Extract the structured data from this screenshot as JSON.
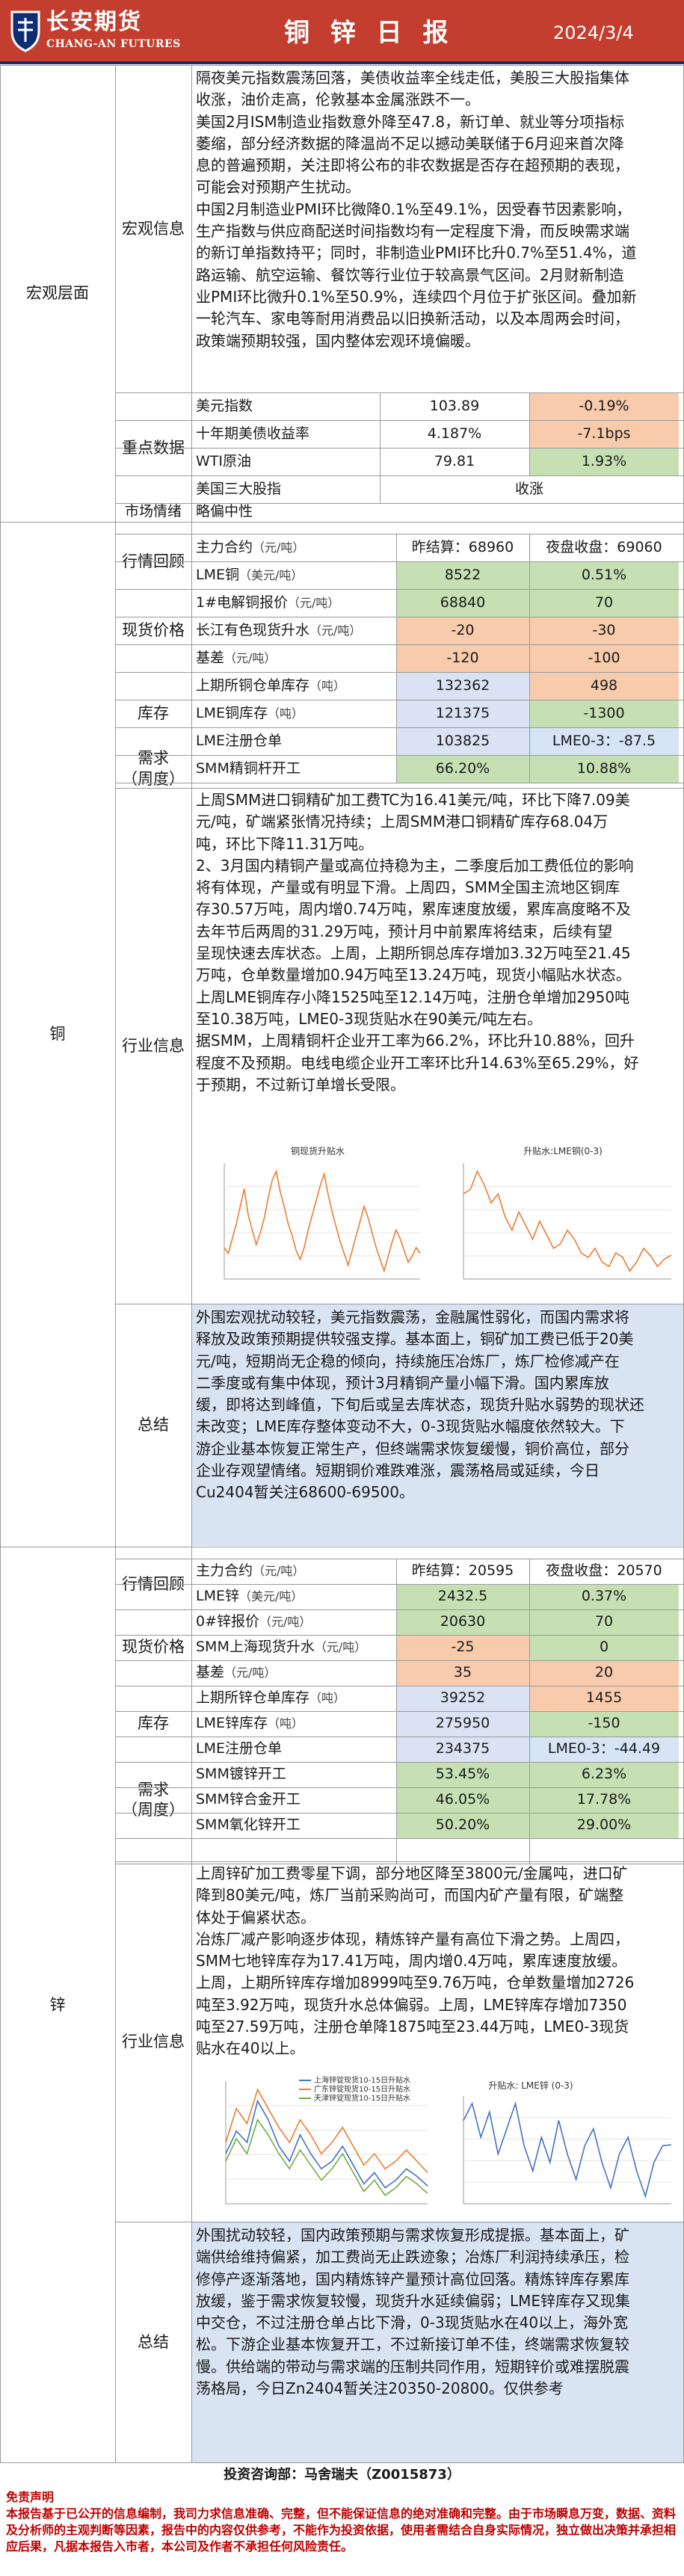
{
  "header": {
    "company_cn": "长安期货",
    "company_en": "CHANG-AN FUTURES",
    "title": "铜 锌 日 报",
    "date": "2024/3/4"
  },
  "macro": {
    "section_label": "宏观层面",
    "info_label": "宏观信息",
    "info_text": "隔夜美元指数震荡回落，美债收益率全线走低，美股三大股指集体\n收涨，油价走高，伦敦基本金属涨跌不一。\n美国2月ISM制造业指数意外降至47.8，新订单、就业等分项指标\n萎缩，部分经济数据的降温尚不足以撼动美联储于6月迎来首次降\n息的普遍预期，关注即将公布的非农数据是否存在超预期的表现，\n可能会对预期产生扰动。\n中国2月制造业PMI环比微降0.1%至49.1%，因受春节因素影响，\n生产指数与供应商配送时间指数均有一定程度下滑，而反映需求端\n的新订单指数持平；同时，非制造业PMI环比升0.7%至51.4%，道\n路运输、航空运输、餐饮等行业位于较高景气区间。2月财新制造\n业PMI环比微升0.1%至50.9%，连续四个月位于扩张区间。叠加新\n一轮汽车、家电等耐用消费品以旧换新活动，以及本周两会时间，\n政策端预期较强，国内整体宏观环境偏暖。",
    "indicators_label": "重点数据",
    "indicators": [
      {
        "name": "美元指数",
        "value": "103.89",
        "change": "-0.19%"
      },
      {
        "name": "十年期美债收益率",
        "value": "4.187%",
        "change": "-7.1bps"
      },
      {
        "name": "WTI原油",
        "value": "79.81",
        "change": "1.93%"
      },
      {
        "name": "美国三大股指",
        "value": "",
        "change": "收涨"
      }
    ],
    "sentiment_label": "市场情绪",
    "sentiment_value": "略偏中性"
  },
  "copper": {
    "section_label": "铜",
    "market_label": "行情回顾",
    "main_contract": "主力合约",
    "main_contract_unit": "（元/吨）",
    "close_label": "昨结算：68960",
    "night_label": "夜盘收盘：69060",
    "lme_name": "LME铜",
    "lme_unit": "（美元/吨）",
    "lme_value": "8522",
    "lme_change": "0.51%",
    "spot_label": "现货价格",
    "spot_rows": [
      {
        "name": "1#电解铜报价",
        "unit": "（元/吨）",
        "value": "68840",
        "change": "70"
      },
      {
        "name": "长江有色现货升水",
        "unit": "（元/吨）",
        "value": "-20",
        "change": "-30"
      },
      {
        "name": "基差",
        "unit": "（元/吨）",
        "value": "-120",
        "change": "-100"
      }
    ],
    "inventory_label": "库存",
    "inventory_rows": [
      {
        "name": "上期所铜仓单库存",
        "unit": "（吨）",
        "value": "132362",
        "change": "498"
      },
      {
        "name": "LME铜库存",
        "unit": "（吨）",
        "value": "121375",
        "change": "-1300"
      },
      {
        "name": "LME注册仓单",
        "unit": "",
        "value": "103825",
        "change": "LME0-3：-87.5"
      }
    ],
    "demand_label": "需求\n（周度）",
    "demand_rows": [
      {
        "name": "SMM精铜杆开工",
        "value": "66.20%",
        "change": "10.88%"
      }
    ],
    "industry_label": "行业信息",
    "industry_text": "上周SMM进口铜精矿加工费TC为16.41美元/吨，环比下降7.09美\n元/吨，矿端紧张情况持续；上周SMM港口铜精矿库存68.04万\n吨，环比下降11.31万吨。\n2、3月国内精铜产量或高位持稳为主，二季度后加工费低位的影响\n将有体现，产量或有明显下滑。上周四，SMM全国主流地区铜库\n存30.57万吨，周内增0.74万吨，累库速度放缓，累库高度略不及\n去年节后两周的31.29万吨，预计月中前累库将结束，后续有望\n呈现快速去库状态。上周，上期所铜总库存增加3.32万吨至21.45\n万吨，仓单数量增加0.94万吨至13.24万吨，现货小幅贴水状态。\n上周LME铜库存小降1525吨至12.14万吨，注册仓单增加2950吨\n至10.38万吨，LME0-3现货贴水在90美元/吨左右。\n据SMM，上周精铜杆企业开工率为66.2%，环比升10.88%，回升\n程度不及预期。电线电缆企业开工率环比升14.63%至65.29%，好\n于预期，不过新订单增长受限。",
    "chart1_title": "铜现货升贴水",
    "chart2_title": "升贴水:LME铜(0-3)",
    "summary_label": "总结",
    "summary_text": "外围宏观扰动较轻，美元指数震荡，金融属性弱化，而国内需求将\n释放及政策预期提供较强支撑。基本面上，铜矿加工费已低于20美\n元/吨，短期尚无企稳的倾向，持续施压冶炼厂，炼厂检修减产在\n二季度或有集中体现，预计3月精铜产量小幅下滑。国内累库放\n缓，即将达到峰值，下旬后或呈去库状态，现货升贴水弱势的现状还\n未改变；LME库存整体变动不大，0-3现货贴水幅度依然较大。下\n游企业基本恢复正常生产，但终端需求恢复缓慢，铜价高位，部分\n企业存观望情绪。短期铜价难跌难涨，震荡格局或延续，今日\nCu2404暂关注68600-69500。"
  },
  "zinc": {
    "section_label": "锌",
    "market_label": "行情回顾",
    "main_contract": "主力合约",
    "main_contract_unit": "（元/吨）",
    "close_label": "昨结算：20595",
    "night_label": "夜盘收盘：20570",
    "lme_name": "LME锌",
    "lme_unit": "（美元/吨）",
    "lme_value": "2432.5",
    "lme_change": "0.37%",
    "spot_label": "现货价格",
    "spot_rows": [
      {
        "name": "0#锌报价",
        "unit": "（元/吨）",
        "value": "20630",
        "change": "70"
      },
      {
        "name": "SMM上海现货升水",
        "unit": "（元/吨）",
        "value": "-25",
        "change": "0"
      },
      {
        "name": "基差",
        "unit": "（元/吨）",
        "value": "35",
        "change": "20"
      }
    ],
    "inventory_label": "库存",
    "inventory_rows": [
      {
        "name": "上期所锌仓单库存",
        "unit": "（吨）",
        "value": "39252",
        "change": "1455"
      },
      {
        "name": "LME锌库存",
        "unit": "（吨）",
        "value": "275950",
        "change": "-150"
      },
      {
        "name": "LME注册仓单",
        "unit": "",
        "value": "234375",
        "change": "LME0-3：-44.49"
      }
    ],
    "demand_label": "需求\n（周度）",
    "demand_rows": [
      {
        "name": "SMM镀锌开工",
        "value": "53.45%",
        "change": "6.23%"
      },
      {
        "name": "SMM锌合金开工",
        "value": "46.05%",
        "change": "17.78%"
      },
      {
        "name": "SMM氧化锌开工",
        "value": "50.20%",
        "change": "29.00%"
      }
    ],
    "industry_label": "行业信息",
    "industry_text": "上周锌矿加工费零星下调，部分地区降至3800元/金属吨，进口矿\n降到80美元/吨，炼厂当前采购尚可，而国内矿产量有限，矿端整\n体处于偏紧状态。\n冶炼厂减产影响逐步体现，精炼锌产量有高位下滑之势。上周四，\nSMM七地锌库存为17.41万吨，周内增0.4万吨，累库速度放缓。\n上周，上期所锌库存增加8999吨至9.76万吨，仓单数量增加2726\n吨至3.92万吨，现货升水总体偏弱。上周，LME锌库存增加7350\n吨至27.59万吨，注册仓单降1875吨至23.44万吨，LME0-3现货\n贴水在40以上。",
    "chart1_legend": [
      "上海锌锭现货10-15日升贴水",
      "广东锌锭现货10-15日升贴水",
      "天津锌锭现货10-15日升贴水"
    ],
    "chart2_title": "升贴水: LME锌 (0-3)",
    "summary_label": "总结",
    "summary_text": "外围扰动较轻，国内政策预期与需求恢复形成提振。基本面上，矿\n端供给维持偏紧，加工费尚无止跌迹象；冶炼厂利润持续承压，检\n修停产逐渐落地，国内精炼锌产量预计高位回落。精炼锌库存累库\n放缓，鉴于需求恢复较慢，现货升水延续偏弱；LME锌库存又现集\n中交仓，不过注册仓单占比下滑，0-3现货贴水在40以上，海外宽\n松。下游企业基本恢复开工，不过新接订单不佳，终端需求恢复较\n慢。供给端的带动与需求端的压制共同作用，短期锌价或难摆脱震\n荡格局，今日Zn2404暂关注20350-20800。仅供参考"
  },
  "footer": {
    "contact": "投资咨询部：马舍瑞夫（Z0015873）",
    "disclaimer_title": "免责声明",
    "disclaimer_text": "本报告基于已公开的信息编制，我司力求信息准确、完整，但不能保证信息的绝对准确和完整。由于市场瞬息万变，数据、资料及分析师的主观判断等因素，报告中的内容仅供参考，不能作为投资依据，使用者需结合自身实际情况，独立做出决策并承担相应后果，凡据本报告入市者，本公司及作者不承担任何风险责任。"
  },
  "colors": {
    "header_red": "#c43e2f",
    "accent_blue": "#0f2d73",
    "up_green": "#c6e0b4",
    "down_peach": "#f8cbad",
    "summary_blue": "#d9e4f3",
    "disclaimer_red": "#c00000"
  },
  "chart_data": [
    {
      "type": "line",
      "title": "铜现货升贴水",
      "series": [
        {
          "values": [
            -20,
            -40,
            10,
            60,
            120,
            180,
            90,
            40,
            -10,
            30,
            80,
            150,
            210,
            240,
            170,
            120,
            60,
            20,
            -30,
            -60,
            -20,
            40,
            90,
            140,
            190,
            230,
            160,
            100,
            50,
            0,
            -40,
            -80,
            -30,
            20,
            70,
            120,
            80,
            30,
            -20,
            -60,
            -100,
            -50,
            0,
            40,
            10,
            -30,
            -70,
            -50,
            -20,
            -40
          ]
        }
      ]
    },
    {
      "type": "line",
      "title": "升贴水:LME铜(0-3)",
      "series": [
        {
          "values": [
            -20,
            -15,
            5,
            -10,
            -30,
            -20,
            -45,
            -60,
            -40,
            -55,
            -70,
            -50,
            -65,
            -80,
            -75,
            -60,
            -70,
            -85,
            -90,
            -80,
            -95,
            -100,
            -85,
            -90,
            -105,
            -95,
            -80,
            -88,
            -100,
            -92,
            -87.5
          ]
        }
      ]
    },
    {
      "type": "line",
      "series": [
        {
          "name": "上海锌锭现货10-15日升贴水",
          "values": [
            60,
            120,
            90,
            200,
            150,
            80,
            40,
            110,
            60,
            20,
            40,
            80,
            30,
            -20,
            10,
            -30,
            -10,
            20,
            0,
            -25
          ]
        },
        {
          "name": "广东锌锭现货10-15日升贴水",
          "values": [
            90,
            180,
            140,
            230,
            180,
            130,
            90,
            150,
            110,
            60,
            90,
            130,
            80,
            30,
            60,
            20,
            40,
            70,
            40,
            10
          ]
        },
        {
          "name": "天津锌锭现货10-15日升贴水",
          "values": [
            40,
            100,
            60,
            150,
            110,
            60,
            20,
            70,
            30,
            -10,
            20,
            60,
            10,
            -40,
            -10,
            -50,
            -30,
            0,
            -20,
            -45
          ]
        }
      ]
    },
    {
      "type": "line",
      "title": "升贴水: LME锌 (0-3)",
      "series": [
        {
          "values": [
            -30,
            -20,
            -40,
            -25,
            -50,
            -35,
            -20,
            -45,
            -60,
            -40,
            -55,
            -30,
            -50,
            -65,
            -45,
            -35,
            -55,
            -70,
            -50,
            -40,
            -60,
            -75,
            -55,
            -45,
            -44.49
          ]
        }
      ]
    }
  ]
}
